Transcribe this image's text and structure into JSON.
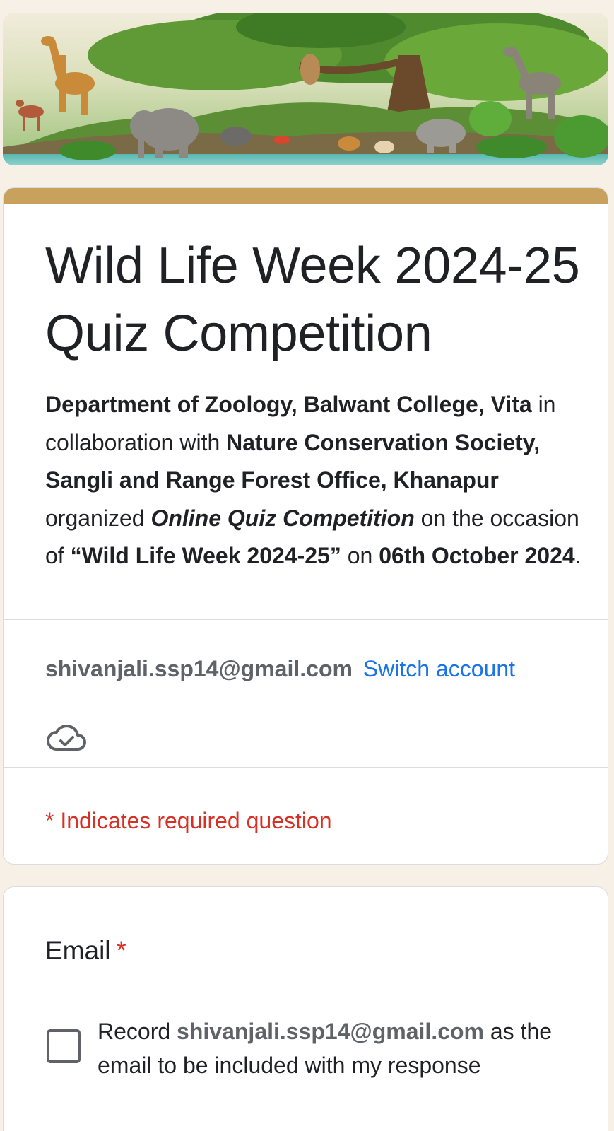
{
  "banner": {
    "image_description_icon": "wildlife-banner-image"
  },
  "form": {
    "title": "Wild Life Week 2024-25 Quiz Competition",
    "description": {
      "org": "Department of Zoology, Balwant College, Vita",
      "collab_prefix": " in collaboration with ",
      "partners": "Nature Conservation Society, Sangli and Range Forest Office, Khanapur",
      "organized": " organized ",
      "event": "Online Quiz Competition",
      "occasion_prefix": " on the occasion of ",
      "occasion": "“Wild Life Week 2024-25”",
      "on": " on ",
      "date": "06th October 2024",
      "end": "."
    },
    "account_email": "shivanjali.ssp14@gmail.com",
    "switch_account": "Switch account",
    "cloud_icon": "cloud-check-icon",
    "required_note": "* Indicates required question"
  },
  "email_question": {
    "label": "Email",
    "required_star": "*",
    "record_prefix": "Record ",
    "record_email": "shivanjali.ssp14@gmail.com",
    "record_suffix": " as the email to be included with my response",
    "checked": false
  },
  "colors": {
    "accent": "#c8a25c",
    "link": "#1a73e8",
    "required": "#d93025",
    "background": "#f6f0e6"
  }
}
